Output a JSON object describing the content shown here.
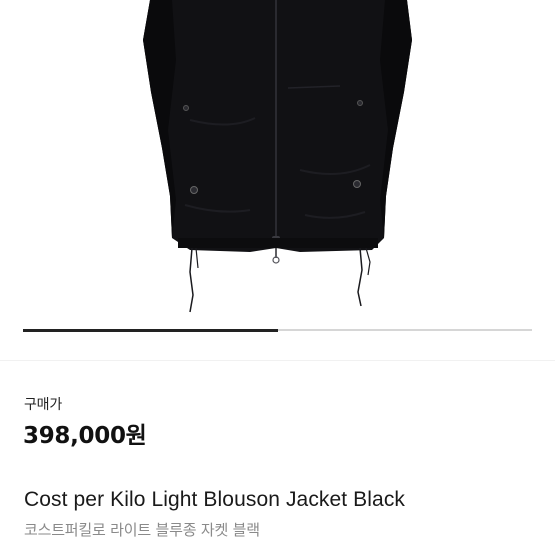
{
  "carousel": {
    "progress_fraction": 0.5
  },
  "price": {
    "label": "구매가",
    "value": "398,000원"
  },
  "product": {
    "title": "Cost per Kilo Light Blouson Jacket Black",
    "subtitle": "코스트퍼킬로 라이트 블루종 자켓 블랙"
  },
  "colors": {
    "jacket": "#111114",
    "progress_active": "#222222",
    "progress_track": "#d6d6d6",
    "subtitle": "#8a8a8a"
  }
}
